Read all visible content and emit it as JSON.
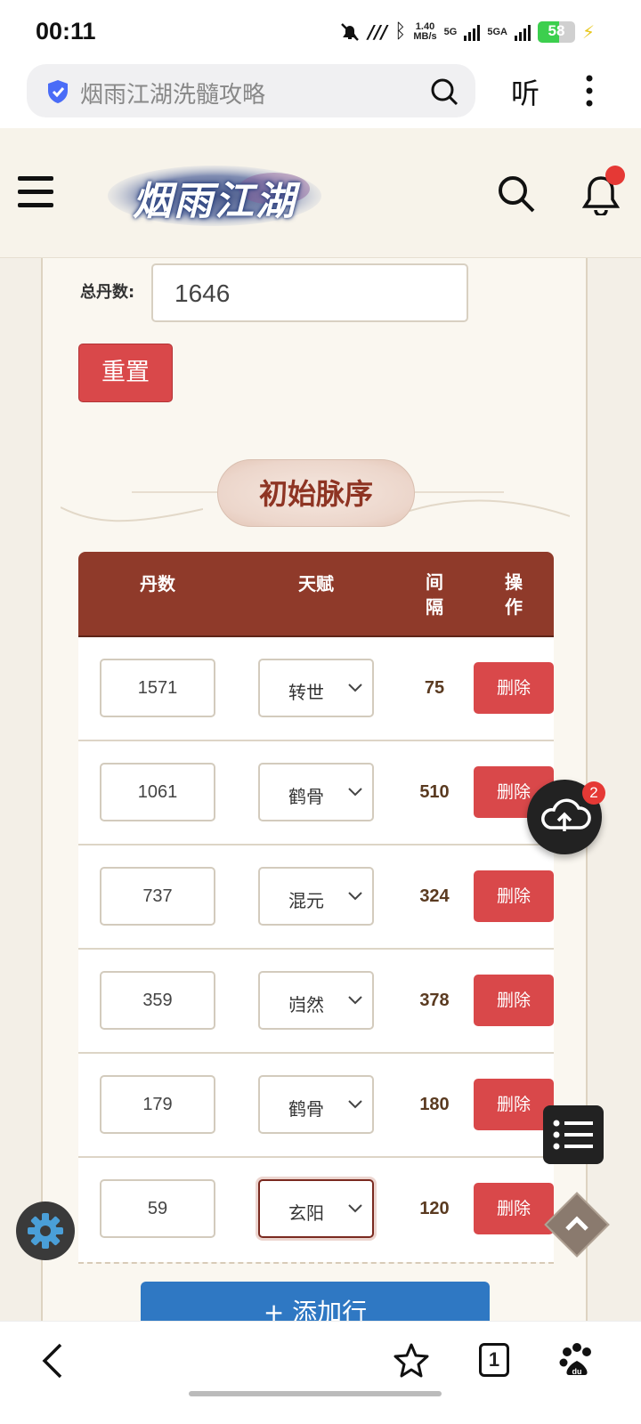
{
  "status_bar": {
    "time": "00:11",
    "speed_value": "1.40",
    "speed_unit": "MB/s",
    "net1": "5G",
    "net2": "5GA",
    "battery": "58",
    "battery_level": 0.58
  },
  "browser": {
    "url_text": "烟雨江湖洗髓攻略",
    "listen_label": "听"
  },
  "site": {
    "logo_text": "烟雨江湖"
  },
  "form": {
    "total_label": "总丹数:",
    "total_value": "1646",
    "reset_label": "重置"
  },
  "section_title": "初始脉序",
  "table": {
    "headers": {
      "dan": "丹数",
      "talent": "天赋",
      "gap": "间\n隔",
      "op": "操\n作"
    },
    "rows": [
      {
        "dan": "1571",
        "talent": "转世",
        "gap": "75",
        "op": "删除"
      },
      {
        "dan": "1061",
        "talent": "鹤骨",
        "gap": "510",
        "op": "删除"
      },
      {
        "dan": "737",
        "talent": "混元",
        "gap": "324",
        "op": "删除"
      },
      {
        "dan": "359",
        "talent": "岿然",
        "gap": "378",
        "op": "删除"
      },
      {
        "dan": "179",
        "talent": "鹤骨",
        "gap": "180",
        "op": "删除"
      },
      {
        "dan": "59",
        "talent": "玄阳",
        "gap": "120",
        "op": "删除"
      }
    ],
    "add_label": "+ 添加行"
  },
  "floating": {
    "cloud_badge": "2"
  },
  "bottom_nav": {
    "tab_count": "1"
  },
  "colors": {
    "accent_red": "#d9484a",
    "header_brown": "#8f3a2a",
    "add_blue": "#2f78c3"
  }
}
